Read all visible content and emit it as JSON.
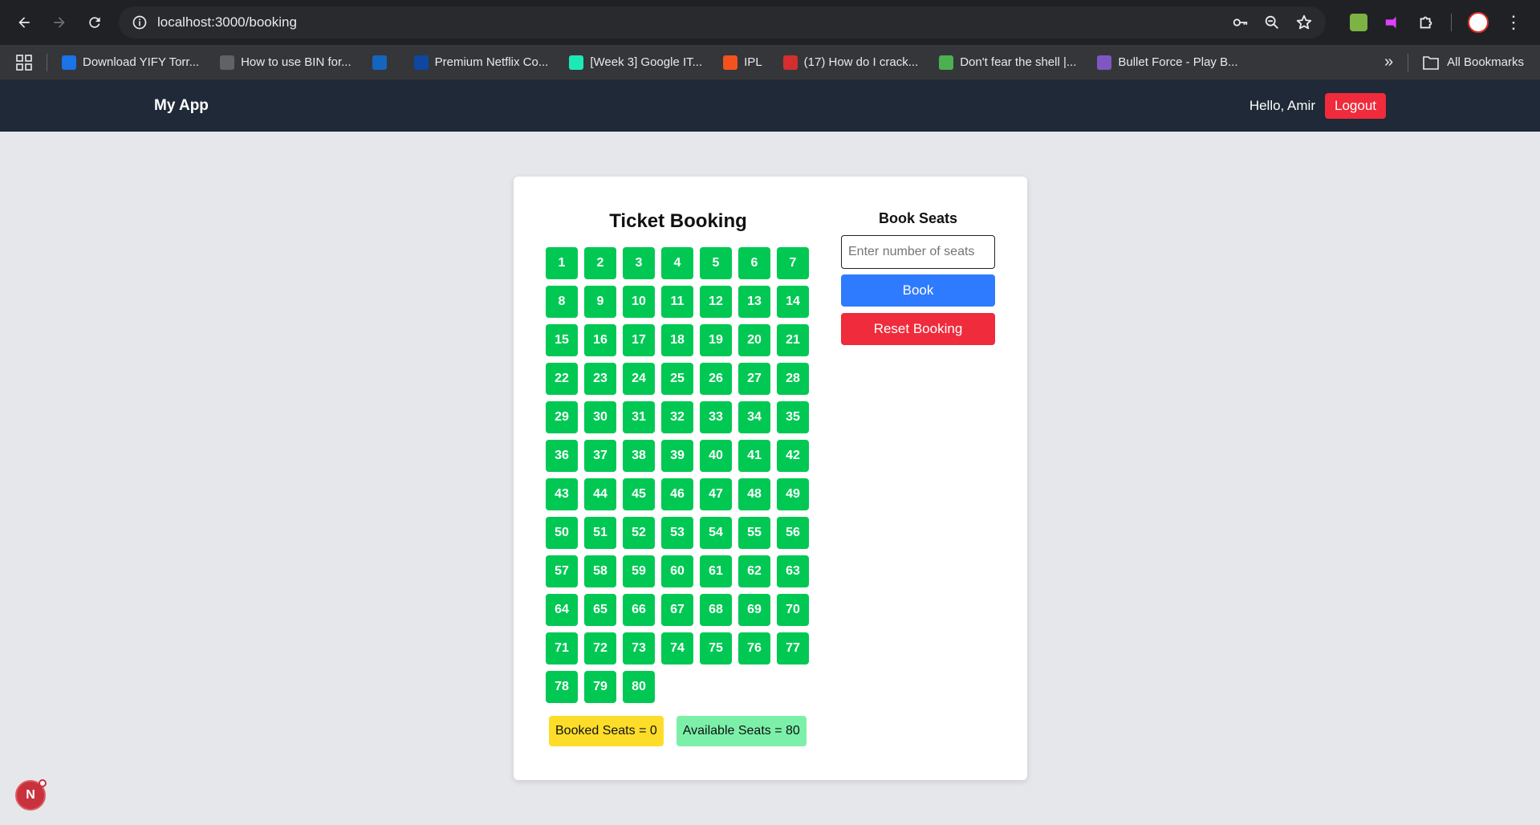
{
  "browser": {
    "url": "localhost:3000/booking",
    "bookmarks": [
      {
        "label": "Download YIFY Torr...",
        "color": "#1a73e8"
      },
      {
        "label": "How to use BIN for...",
        "color": "#5f6368"
      },
      {
        "label": "",
        "color": "#1565c0"
      },
      {
        "label": "Premium Netflix Co...",
        "color": "#0d47a1"
      },
      {
        "label": "[Week 3] Google IT...",
        "color": "#1de9b6"
      },
      {
        "label": "IPL",
        "color": "#f4511e"
      },
      {
        "label": "(17) How do I crack...",
        "color": "#d32f2f"
      },
      {
        "label": "Don't fear the shell |...",
        "color": "#4caf50"
      },
      {
        "label": "Bullet Force - Play B...",
        "color": "#7e57c2"
      }
    ],
    "all_bookmarks_label": "All Bookmarks"
  },
  "header": {
    "brand": "My App",
    "greeting": "Hello, Amir",
    "logout_label": "Logout"
  },
  "booking": {
    "title": "Ticket Booking",
    "seats": [
      1,
      2,
      3,
      4,
      5,
      6,
      7,
      8,
      9,
      10,
      11,
      12,
      13,
      14,
      15,
      16,
      17,
      18,
      19,
      20,
      21,
      22,
      23,
      24,
      25,
      26,
      27,
      28,
      29,
      30,
      31,
      32,
      33,
      34,
      35,
      36,
      37,
      38,
      39,
      40,
      41,
      42,
      43,
      44,
      45,
      46,
      47,
      48,
      49,
      50,
      51,
      52,
      53,
      54,
      55,
      56,
      57,
      58,
      59,
      60,
      61,
      62,
      63,
      64,
      65,
      66,
      67,
      68,
      69,
      70,
      71,
      72,
      73,
      74,
      75,
      76,
      77,
      78,
      79,
      80
    ],
    "seat_color": "#00c853",
    "booked_label": "Booked Seats = 0",
    "available_label": "Available Seats = 80"
  },
  "form": {
    "title": "Book Seats",
    "input_placeholder": "Enter number of seats",
    "input_value": "",
    "book_label": "Book",
    "reset_label": "Reset Booking"
  },
  "dev_badge": {
    "label": "N"
  }
}
